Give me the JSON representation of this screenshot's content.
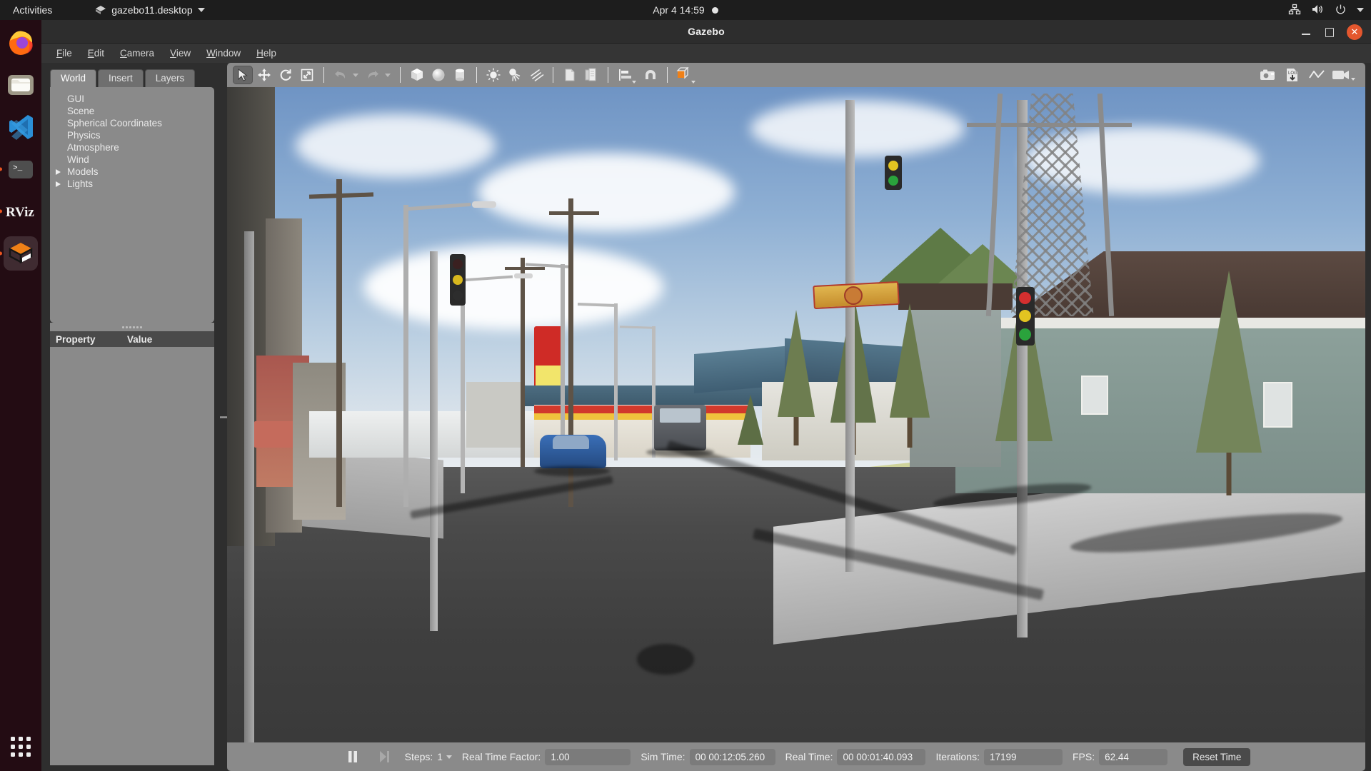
{
  "desktop": {
    "topbar": {
      "activities": "Activities",
      "app_menu": "gazebo11.desktop",
      "app_menu_icon": "gazebo-icon",
      "clock": "Apr 4  14:59",
      "recording_indicator": "dot-indicator",
      "status_icons": [
        "network-icon",
        "volume-icon",
        "power-icon",
        "chevron-down-icon"
      ]
    },
    "dock": {
      "items": [
        {
          "name": "firefox",
          "label": "Firefox",
          "running": false,
          "active": false
        },
        {
          "name": "files",
          "label": "Files",
          "running": false,
          "active": false
        },
        {
          "name": "vscode",
          "label": "Visual Studio Code",
          "running": false,
          "active": false
        },
        {
          "name": "terminal",
          "label": "Terminal",
          "running": true,
          "active": false
        },
        {
          "name": "rviz",
          "label": "RViz",
          "running": true,
          "active": false
        },
        {
          "name": "gazebo",
          "label": "Gazebo",
          "running": true,
          "active": true
        }
      ],
      "show_apps": "show-applications"
    }
  },
  "window": {
    "title": "Gazebo",
    "controls": {
      "minimize": "minimize",
      "maximize": "maximize",
      "close": "close"
    }
  },
  "menubar": {
    "items": [
      {
        "mnemonic": "F",
        "rest": "ile",
        "name": "file"
      },
      {
        "mnemonic": "E",
        "rest": "dit",
        "name": "edit"
      },
      {
        "mnemonic": "C",
        "rest": "amera",
        "name": "camera"
      },
      {
        "mnemonic": "V",
        "rest": "iew",
        "name": "view"
      },
      {
        "mnemonic": "W",
        "rest": "indow",
        "name": "window"
      },
      {
        "mnemonic": "H",
        "rest": "elp",
        "name": "help"
      }
    ]
  },
  "left_panel": {
    "tabs": [
      {
        "label": "World",
        "active": true
      },
      {
        "label": "Insert",
        "active": false
      },
      {
        "label": "Layers",
        "active": false
      }
    ],
    "tree": [
      {
        "label": "GUI",
        "expandable": false
      },
      {
        "label": "Scene",
        "expandable": false
      },
      {
        "label": "Spherical Coordinates",
        "expandable": false
      },
      {
        "label": "Physics",
        "expandable": false
      },
      {
        "label": "Atmosphere",
        "expandable": false
      },
      {
        "label": "Wind",
        "expandable": false
      },
      {
        "label": "Models",
        "expandable": true
      },
      {
        "label": "Lights",
        "expandable": true
      }
    ],
    "property_table": {
      "columns": [
        "Property",
        "Value"
      ],
      "rows": []
    }
  },
  "toolbar": {
    "left_tools": [
      {
        "name": "select-mode",
        "icon": "cursor-arrow-icon",
        "pressed": true
      },
      {
        "name": "translate-mode",
        "icon": "move-arrows-icon",
        "pressed": false
      },
      {
        "name": "rotate-mode",
        "icon": "rotate-icon",
        "pressed": false
      },
      {
        "name": "scale-mode",
        "icon": "scale-icon",
        "pressed": false
      }
    ],
    "history_tools": [
      {
        "name": "undo",
        "icon": "undo-arrow-icon",
        "has_dropdown": true
      },
      {
        "name": "redo",
        "icon": "redo-arrow-icon",
        "has_dropdown": true
      }
    ],
    "shape_tools": [
      {
        "name": "insert-box",
        "icon": "box-icon"
      },
      {
        "name": "insert-sphere",
        "icon": "sphere-icon"
      },
      {
        "name": "insert-cylinder",
        "icon": "cylinder-icon"
      }
    ],
    "light_tools": [
      {
        "name": "insert-point-light",
        "icon": "point-light-icon"
      },
      {
        "name": "insert-spot-light",
        "icon": "spot-light-icon"
      },
      {
        "name": "insert-directional-light",
        "icon": "directional-light-icon"
      }
    ],
    "clipboard_tools": [
      {
        "name": "copy",
        "icon": "copy-icon"
      },
      {
        "name": "paste",
        "icon": "paste-icon"
      }
    ],
    "align_tools": [
      {
        "name": "align",
        "icon": "align-icon",
        "has_dropdown": true
      },
      {
        "name": "snap",
        "icon": "magnet-icon",
        "has_dropdown": false
      },
      {
        "name": "view-angle",
        "icon": "view-cube-icon",
        "has_dropdown": true,
        "accent": "#ef8017"
      }
    ],
    "right_tools": [
      {
        "name": "screenshot",
        "icon": "camera-icon"
      },
      {
        "name": "log-record",
        "icon": "log-download-icon",
        "label": "LOG"
      },
      {
        "name": "plot",
        "icon": "line-chart-icon"
      },
      {
        "name": "video-record",
        "icon": "video-camera-icon",
        "has_dropdown": true
      }
    ]
  },
  "statusbar": {
    "play_pause": {
      "name": "pause-button",
      "icon": "pause-icon"
    },
    "step": {
      "name": "step-button",
      "icon": "step-forward-icon"
    },
    "steps_label": "Steps:",
    "steps_value": "1",
    "rtf_label": "Real Time Factor:",
    "rtf_value": "1.00",
    "sim_time_label": "Sim Time:",
    "sim_time_value": "00 00:12:05.260",
    "real_time_label": "Real Time:",
    "real_time_value": "00 00:01:40.093",
    "iterations_label": "Iterations:",
    "iterations_value": "17199",
    "fps_label": "FPS:",
    "fps_value": "62.44",
    "reset_button": "Reset Time"
  },
  "scene": {
    "description": "3D simulated suburban street with road, sidewalks, houses, gas station, power line poles, street lamps, traffic lights, parked cars and pine trees under a partly cloudy sky",
    "colors": {
      "sky_top": "#6f94c4",
      "sky_bottom": "#eef1f3",
      "asphalt": "#4a4a4a",
      "sidewalk": "#bdbdbd",
      "grass": "#c6cc91",
      "tree_green": "#6f7f52",
      "roof_blue": "#3d5a6c",
      "house_teal": "#7e938e",
      "car_blue": "#2f5fa8",
      "traffic_red": "#d32f2f",
      "traffic_yellow": "#e3c421",
      "traffic_green": "#2aa33c",
      "sign_orange": "#e8932b"
    }
  }
}
